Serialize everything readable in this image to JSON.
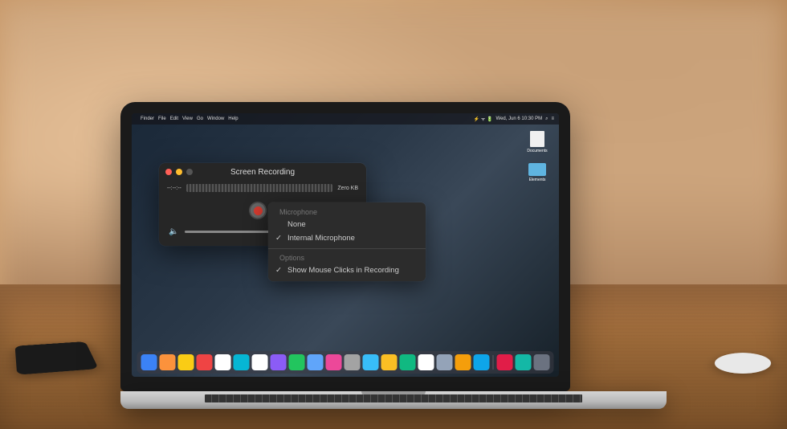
{
  "menubar": {
    "app": "Finder",
    "items": [
      "File",
      "Edit",
      "View",
      "Go",
      "Window",
      "Help"
    ],
    "datetime": "Wed, Jun 6 10:30 PM"
  },
  "desktop": {
    "icon1_label": "Documents",
    "icon2_label": "Elements"
  },
  "recording_window": {
    "title": "Screen Recording",
    "time": "--:--:--",
    "size": "Zero KB"
  },
  "dropdown": {
    "section1_header": "Microphone",
    "item_none": "None",
    "item_internal": "Internal Microphone",
    "section2_header": "Options",
    "item_clicks": "Show Mouse Clicks in Recording"
  },
  "dock_colors": [
    "#3b82f6",
    "#fb923c",
    "#facc15",
    "#ef4444",
    "#ffffff",
    "#06b6d4",
    "#ffffff",
    "#8b5cf6",
    "#22c55e",
    "#60a5fa",
    "#ec4899",
    "#a3a3a3",
    "#38bdf8",
    "#fbbf24",
    "#10b981",
    "#ffffff",
    "#94a3b8",
    "#f59e0b",
    "#0ea5e9",
    "#e11d48",
    "#14b8a6",
    "#6b7280"
  ]
}
